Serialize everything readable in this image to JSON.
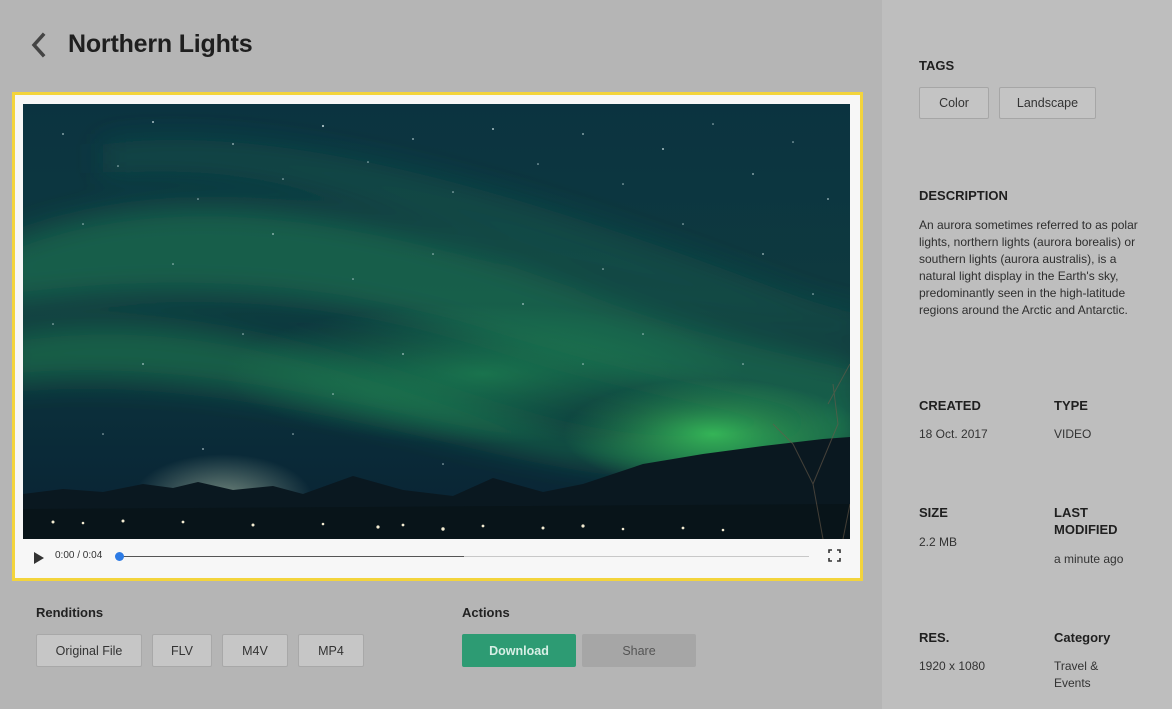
{
  "header": {
    "title": "Northern Lights",
    "back_icon": "chevron-left-icon"
  },
  "player": {
    "time": "0:00 / 0:04",
    "progress": 0,
    "buffered": 0.5,
    "accent": "#2d7be5",
    "frame_color": "#f3d43c"
  },
  "renditions": {
    "label": "Renditions",
    "items": [
      "Original File",
      "FLV",
      "M4V",
      "MP4"
    ]
  },
  "actions": {
    "label": "Actions",
    "download": "Download",
    "share": "Share",
    "download_color": "#2d9b73"
  },
  "sidebar": {
    "tags_label": "TAGS",
    "tags": [
      "Color",
      "Landscape"
    ],
    "description_label": "DESCRIPTION",
    "description": "An aurora sometimes referred to as polar lights, northern lights (aurora borealis) or southern lights (aurora australis), is a natural light display in the Earth's sky, predominantly seen in the high-latitude regions around the Arctic and Antarctic.",
    "created_label": "CREATED",
    "created": "18 Oct. 2017",
    "type_label": "TYPE",
    "type": "VIDEO",
    "size_label": "SIZE",
    "size": "2.2 MB",
    "modified_label": "LAST MODIFIED",
    "modified": "a minute ago",
    "res_label": "RES.",
    "res": "1920 x 1080",
    "category_label": "Category",
    "category": "Travel & Events"
  }
}
